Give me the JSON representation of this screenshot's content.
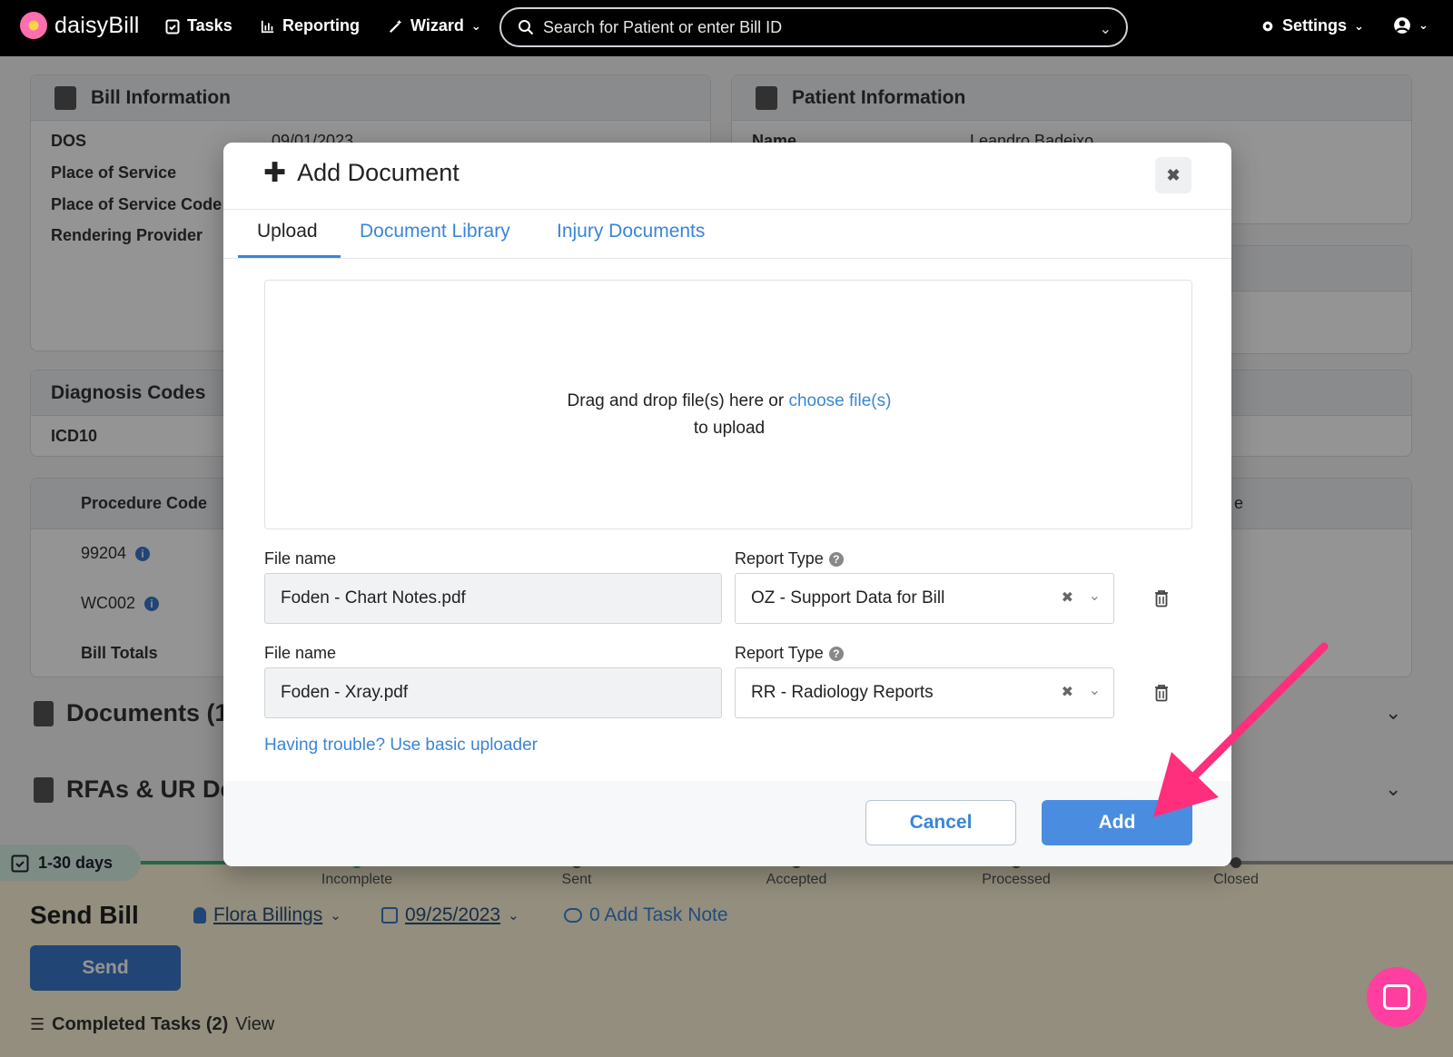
{
  "app": {
    "logo_text": "daisyBill",
    "nav": {
      "tasks": "Tasks",
      "reporting": "Reporting",
      "wizard": "Wizard",
      "settings": "Settings"
    },
    "search_placeholder": "Search for Patient or enter Bill ID"
  },
  "background": {
    "bill_info": {
      "title": "Bill Information",
      "rows": [
        "DOS",
        "Place of Service",
        "Place of Service Code",
        "Rendering Provider"
      ],
      "dos_value": "09/01/2023"
    },
    "patient_info": {
      "title": "Patient Information",
      "name_label": "Name",
      "name_value": "Leandro Badeixo"
    },
    "diagnosis": {
      "title": "Diagnosis Codes",
      "icd": "ICD10"
    },
    "procedures": {
      "header": "Procedure Code",
      "header_right": "e",
      "rows": [
        "99204",
        "WC002"
      ],
      "totals": "Bill Totals"
    },
    "documents_section": "Documents (1)",
    "rfas_section": "RFAs & UR De",
    "task": {
      "days": "1-30 days",
      "steps": [
        "Incomplete",
        "Sent",
        "Accepted",
        "Processed",
        "Closed"
      ],
      "title": "Send Bill",
      "assignee": "Flora Billings",
      "date": "09/25/2023",
      "note": "0 Add Task Note",
      "send_label": "Send",
      "completed_label": "Completed Tasks (2)",
      "view_label": "View"
    }
  },
  "modal": {
    "title": "Add Document",
    "tabs": [
      "Upload",
      "Document Library",
      "Injury Documents"
    ],
    "dropzone": {
      "text_before": "Drag and drop file(s) here or ",
      "link": "choose file(s)",
      "text_after": "to upload"
    },
    "files": [
      {
        "file_label": "File name",
        "file_value": "Foden - Chart Notes.pdf",
        "type_label": "Report Type",
        "type_value": "OZ - Support Data for Bill"
      },
      {
        "file_label": "File name",
        "file_value": "Foden - Xray.pdf",
        "type_label": "Report Type",
        "type_value": "RR - Radiology Reports"
      }
    ],
    "basic_uploader": "Having trouble? Use basic uploader",
    "cancel_label": "Cancel",
    "add_label": "Add"
  },
  "colors": {
    "accent": "#4a8de0",
    "link": "#3a86d6",
    "arrow": "#ff2f7d",
    "chat": "#ff3fa0"
  }
}
